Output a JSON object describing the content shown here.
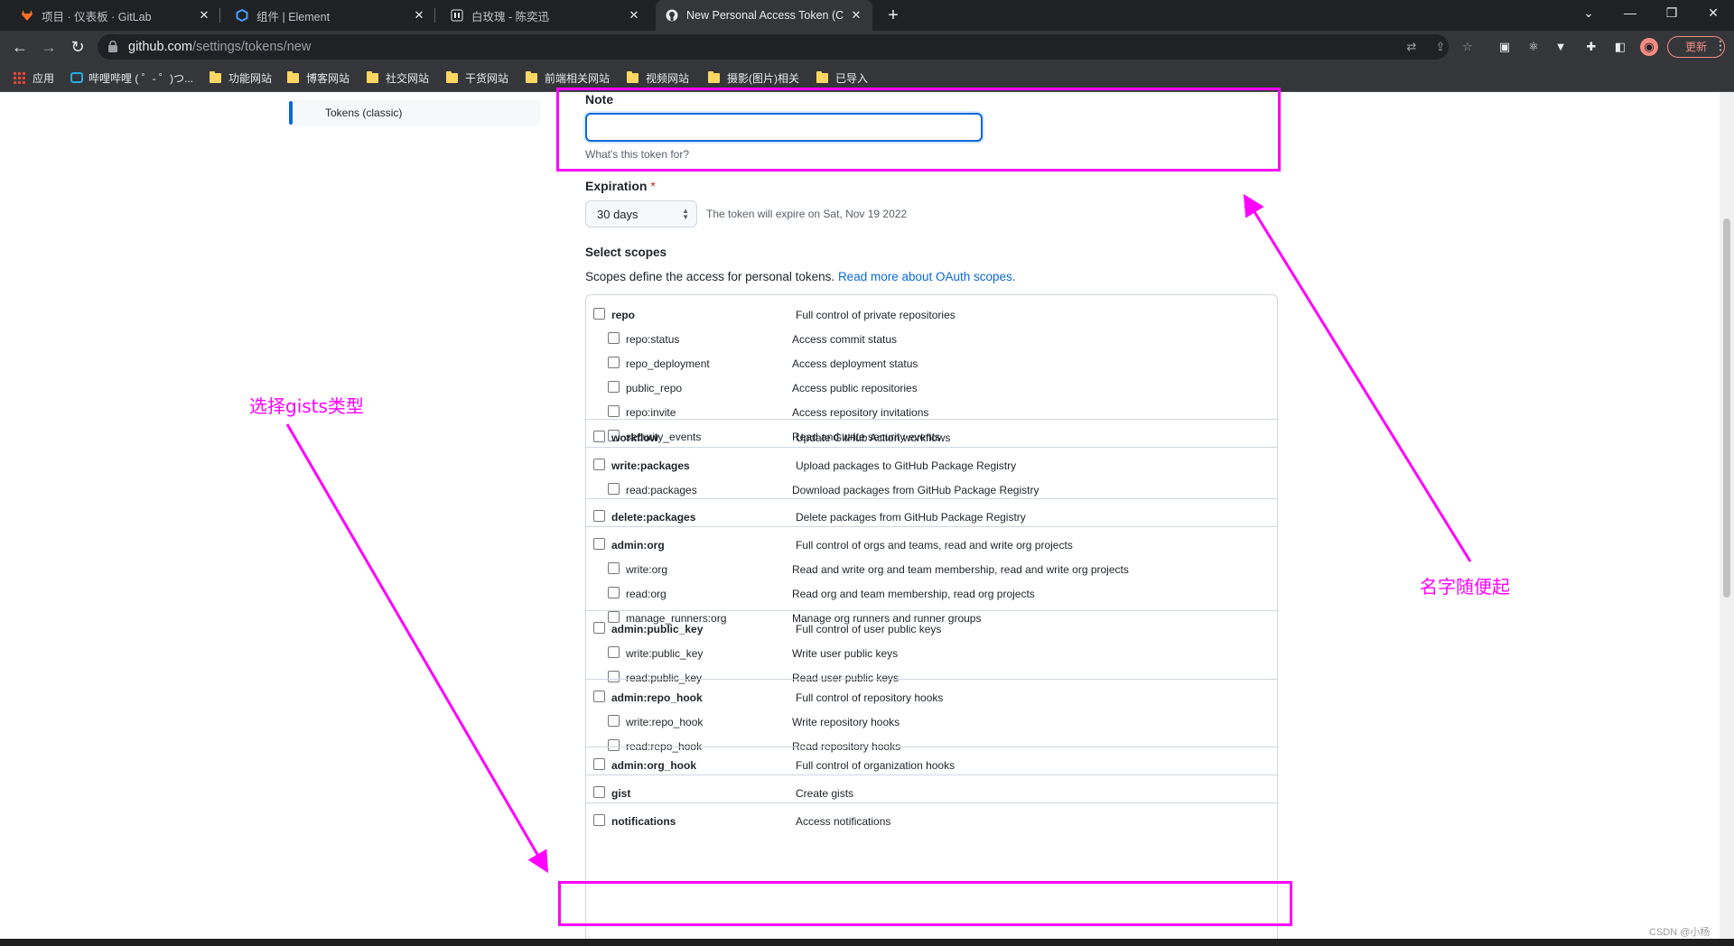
{
  "browser": {
    "tabs": [
      {
        "label": "项目 · 仪表板 · GitLab",
        "icon": "gitlab-icon",
        "active": false
      },
      {
        "label": "组件 | Element",
        "icon": "element-icon",
        "active": false
      },
      {
        "label": "白玫瑰 - 陈奕迅",
        "icon": "music-icon",
        "active": false
      },
      {
        "label": "New Personal Access Token (C",
        "icon": "github-icon",
        "active": true
      }
    ],
    "url_host": "github.com",
    "url_path": "/settings/tokens/new",
    "update_label": "更新",
    "bookmarks": [
      {
        "label": "应用",
        "icon": "apps-icon"
      },
      {
        "label": "哔哩哔哩 ( ゜- ゜)つ...",
        "icon": "bilibili-icon"
      },
      {
        "label": "功能网站",
        "icon": "folder-icon"
      },
      {
        "label": "博客网站",
        "icon": "folder-icon"
      },
      {
        "label": "社交网站",
        "icon": "folder-icon"
      },
      {
        "label": "干货网站",
        "icon": "folder-icon"
      },
      {
        "label": "前端相关网站",
        "icon": "folder-icon"
      },
      {
        "label": "视频网站",
        "icon": "folder-icon"
      },
      {
        "label": "摄影(图片)相关",
        "icon": "folder-icon"
      },
      {
        "label": "已导入",
        "icon": "folder-icon"
      }
    ]
  },
  "sidebar": {
    "active_item": "Tokens (classic)"
  },
  "form": {
    "note_label": "Note",
    "note_value": "",
    "note_hint": "What's this token for?",
    "expiration_label": "Expiration",
    "required_mark": "*",
    "expiration_value": "30 days",
    "expiration_note": "The token will expire on Sat, Nov 19 2022",
    "scopes_title": "Select scopes",
    "scopes_desc": "Scopes define the access for personal tokens.",
    "scopes_link": "Read more about OAuth scopes."
  },
  "scopes": [
    {
      "name": "repo",
      "desc": "Full control of private repositories",
      "sub": [
        {
          "name": "repo:status",
          "desc": "Access commit status"
        },
        {
          "name": "repo_deployment",
          "desc": "Access deployment status"
        },
        {
          "name": "public_repo",
          "desc": "Access public repositories"
        },
        {
          "name": "repo:invite",
          "desc": "Access repository invitations"
        },
        {
          "name": "security_events",
          "desc": "Read and write security events"
        }
      ]
    },
    {
      "name": "workflow",
      "desc": "Update GitHub Action workflows",
      "sub": []
    },
    {
      "name": "write:packages",
      "desc": "Upload packages to GitHub Package Registry",
      "sub": [
        {
          "name": "read:packages",
          "desc": "Download packages from GitHub Package Registry"
        }
      ]
    },
    {
      "name": "delete:packages",
      "desc": "Delete packages from GitHub Package Registry",
      "sub": []
    },
    {
      "name": "admin:org",
      "desc": "Full control of orgs and teams, read and write org projects",
      "sub": [
        {
          "name": "write:org",
          "desc": "Read and write org and team membership, read and write org projects"
        },
        {
          "name": "read:org",
          "desc": "Read org and team membership, read org projects"
        },
        {
          "name": "manage_runners:org",
          "desc": "Manage org runners and runner groups"
        }
      ]
    },
    {
      "name": "admin:public_key",
      "desc": "Full control of user public keys",
      "sub": [
        {
          "name": "write:public_key",
          "desc": "Write user public keys"
        },
        {
          "name": "read:public_key",
          "desc": "Read user public keys"
        }
      ]
    },
    {
      "name": "admin:repo_hook",
      "desc": "Full control of repository hooks",
      "sub": [
        {
          "name": "write:repo_hook",
          "desc": "Write repository hooks"
        },
        {
          "name": "read:repo_hook",
          "desc": "Read repository hooks"
        }
      ]
    },
    {
      "name": "admin:org_hook",
      "desc": "Full control of organization hooks",
      "sub": []
    },
    {
      "name": "gist",
      "desc": "Create gists",
      "sub": []
    },
    {
      "name": "notifications",
      "desc": "Access notifications",
      "sub": []
    }
  ],
  "annotations": {
    "left_text": "选择gists类型",
    "right_text": "名字随便起",
    "color": "#ff00ff"
  },
  "watermark": "CSDN @小杨"
}
